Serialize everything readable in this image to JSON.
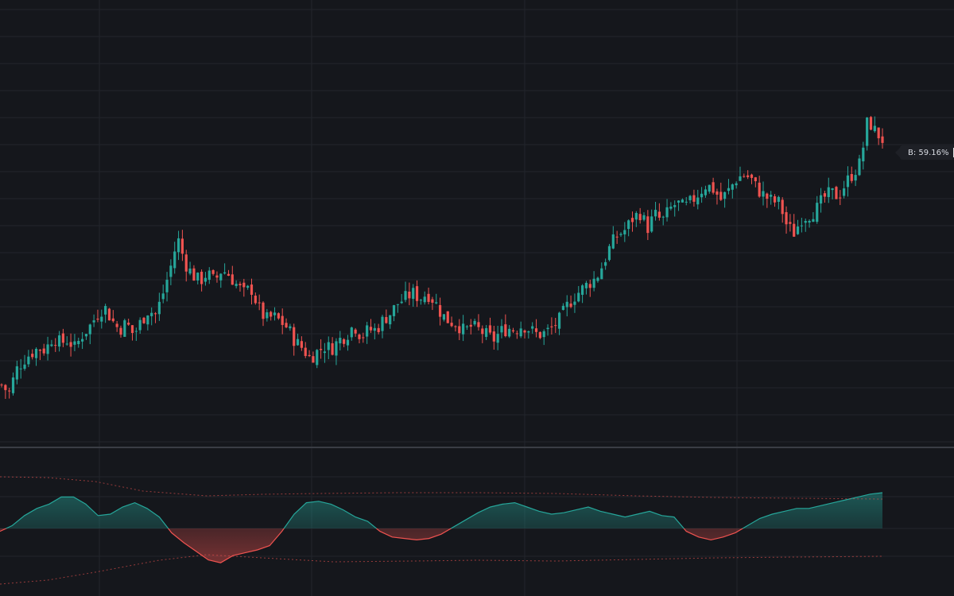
{
  "colors": {
    "background": "#15171c",
    "grid": "#22252c",
    "separator": "#3a3d44",
    "up": "#26a69a",
    "down": "#ef5350"
  },
  "tag": {
    "label": "B: 59.16%"
  },
  "chart_data": [
    {
      "type": "candlestick",
      "grid": true,
      "closes": [
        -0.3,
        -0.8,
        0.6,
        1.2,
        1.6,
        1.9,
        1.8,
        2.6,
        2.2,
        2.4,
        1.9,
        2.7,
        3.2,
        3.9,
        4.4,
        3.6,
        3.0,
        3.4,
        2.7,
        3.5,
        4.2,
        3.9,
        5.2,
        6.7,
        8.5,
        7.0,
        6.3,
        5.9,
        6.4,
        5.9,
        6.6,
        6.3,
        5.7,
        5.2,
        5.5,
        4.3,
        3.6,
        3.8,
        3.5,
        3.1,
        2.3,
        1.9,
        1.3,
        1.7,
        2.0,
        1.9,
        2.4,
        2.7,
        3.3,
        2.6,
        3.0,
        3.0,
        3.6,
        4.0,
        4.6,
        4.9,
        5.2,
        4.9,
        5.2,
        4.7,
        3.9,
        3.5,
        3.4,
        2.9,
        3.2,
        3.0,
        2.7,
        2.4,
        2.9,
        3.1,
        3.0,
        3.3,
        3.0,
        2.7,
        2.8,
        3.1,
        3.6,
        4.4,
        5.0,
        5.4,
        5.8,
        6.1,
        7.0,
        8.1,
        8.7,
        9.0,
        9.7,
        10.0,
        9.1,
        9.9,
        9.5,
        10.2,
        10.6,
        10.3,
        10.7,
        11.2,
        11.7,
        11.4,
        10.8,
        11.3,
        12.0,
        12.3,
        12.1,
        11.4,
        11.0,
        10.7,
        10.6,
        9.2,
        8.8,
        9.7,
        9.9,
        10.2,
        10.9,
        11.2,
        11.0,
        11.8,
        12.4,
        13.0,
        15.6,
        14.9,
        14.4
      ]
    },
    {
      "type": "area",
      "grid": true,
      "values": [
        -0.2,
        0.2,
        0.9,
        1.4,
        1.7,
        2.2,
        2.2,
        1.7,
        0.9,
        1.0,
        1.5,
        1.8,
        1.4,
        0.8,
        -0.3,
        -1.0,
        -1.6,
        -2.2,
        -2.4,
        -1.9,
        -1.7,
        -1.5,
        -1.2,
        -0.2,
        1.0,
        1.8,
        1.9,
        1.7,
        1.3,
        0.8,
        0.5,
        -0.2,
        -0.6,
        -0.7,
        -0.8,
        -0.7,
        -0.4,
        0.1,
        0.6,
        1.1,
        1.5,
        1.7,
        1.8,
        1.5,
        1.2,
        1.0,
        1.1,
        1.3,
        1.5,
        1.2,
        1.0,
        0.8,
        1.0,
        1.2,
        0.9,
        0.8,
        -0.2,
        -0.6,
        -0.8,
        -0.6,
        -0.3,
        0.2,
        0.7,
        1.0,
        1.2,
        1.4,
        1.4,
        1.6,
        1.8,
        2.0,
        2.2,
        2.4,
        2.5
      ]
    }
  ]
}
